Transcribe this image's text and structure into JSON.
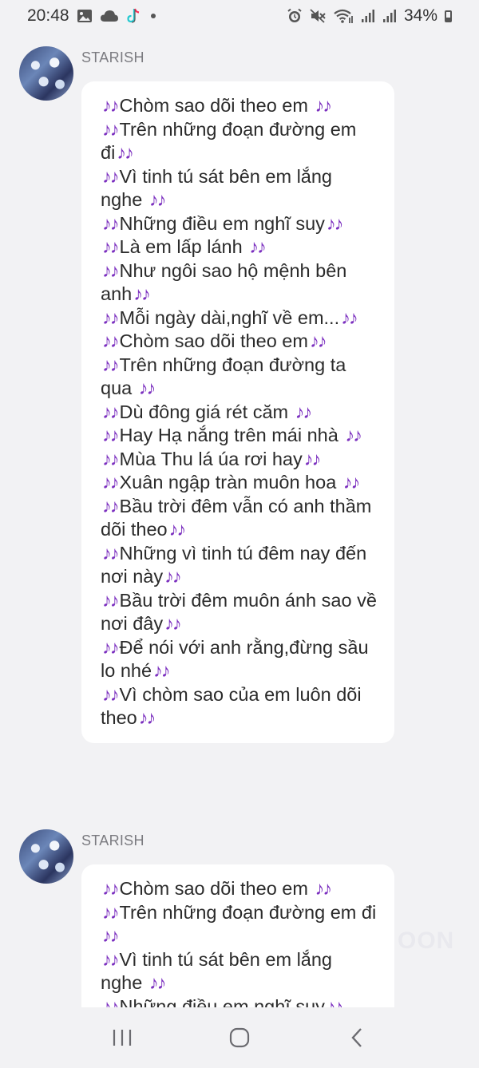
{
  "status_bar": {
    "time": "20:48",
    "left_icons": [
      "gallery-icon",
      "cloud-icon",
      "tiktok-icon",
      "dot-icon"
    ],
    "right_icons": [
      "alarm-icon",
      "mute-icon",
      "wifi-icon",
      "signal-icon",
      "signal-icon"
    ],
    "battery": "34%"
  },
  "messages": [
    {
      "sender": "STARISH",
      "lines": [
        "🎶Chòm sao dõi theo em 🎶",
        "🎶Trên những đoạn đường em đi🎶",
        "🎶Vì tinh tú sát bên em lắng nghe 🎶",
        "🎶Những điều em nghĩ suy🎶",
        "🎶Là em lấp lánh 🎶",
        "🎶Như ngôi sao hộ mệnh bên anh🎶",
        "🎶Mỗi ngày dài,nghĩ về em...🎶",
        "🎶Chòm sao dõi theo em🎶",
        "🎶Trên những đoạn đường ta qua 🎶",
        "🎶Dù đông giá rét căm 🎶",
        "🎶Hay Hạ nắng trên mái nhà 🎶",
        "🎶Mùa Thu lá úa rơi hay🎶",
        "🎶Xuân ngập tràn muôn hoa 🎶",
        "🎶Bầu trời đêm vẫn có anh thầm dõi theo🎶",
        "🎶Những vì tinh tú đêm nay đến nơi này🎶",
        "🎶Bầu trời đêm muôn ánh sao về nơi đây🎶",
        "🎶Để nói với anh rằng,đừng sầu lo nhé🎶",
        "🎶Vì chòm sao của em luôn dõi theo🎶"
      ]
    },
    {
      "sender": "STARISH",
      "lines": [
        "🎶Chòm sao dõi theo em 🎶",
        "🎶Trên những đoạn đường em đi 🎶",
        "🎶Vì tinh tú sát bên em lắng nghe 🎶",
        "🎶Những điều em nghĩ suy🎶"
      ]
    }
  ],
  "watermark": "OON",
  "nav_bar": {
    "buttons": [
      "recent-apps-icon",
      "home-icon",
      "back-icon"
    ]
  },
  "colors": {
    "background": "#f2f2f4",
    "bubble": "#ffffff",
    "note_accent": "#7b2fbf",
    "sender": "#7b7b80"
  }
}
